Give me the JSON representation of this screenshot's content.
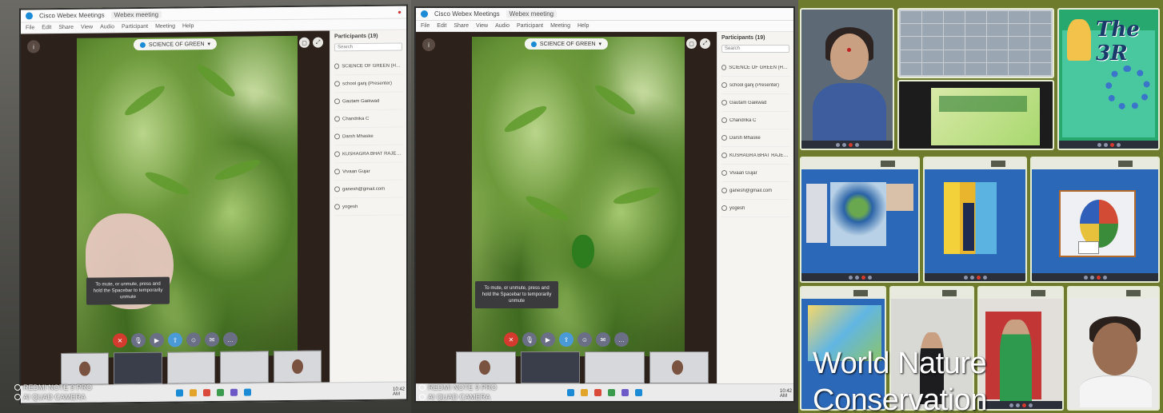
{
  "webex": {
    "window_title": "Cisco Webex Meetings",
    "meeting_tab": "Webex meeting",
    "menu": [
      "File",
      "Edit",
      "Share",
      "View",
      "Audio",
      "Participant",
      "Meeting",
      "Help"
    ],
    "share_badge": "SCIENCE OF GREEN",
    "participants_title": "Participants (19)",
    "search_placeholder": "Search",
    "participants": [
      "SCIENCE OF GREEN (Host, me)",
      "school ganj (Presenter)",
      "Gautam Gaikwad",
      "Chandrika C",
      "Darsh Mhaske",
      "KUSHAGRA BHAT RAJESH",
      "Vivaan Gujar",
      "ganesh@gmail.com",
      "yogesh"
    ],
    "hint_toast": "To mute, or unmute, press and hold the Spacebar to temporarily unmute",
    "clock": "10:42 AM"
  },
  "watermark": {
    "line1": "REDMI NOTE 9 PRO",
    "line2": "AI QUAD CAMERA"
  },
  "collage": {
    "r3_title": "The 3R",
    "caption_line1": "World Nature",
    "caption_line2": "Conservation"
  }
}
